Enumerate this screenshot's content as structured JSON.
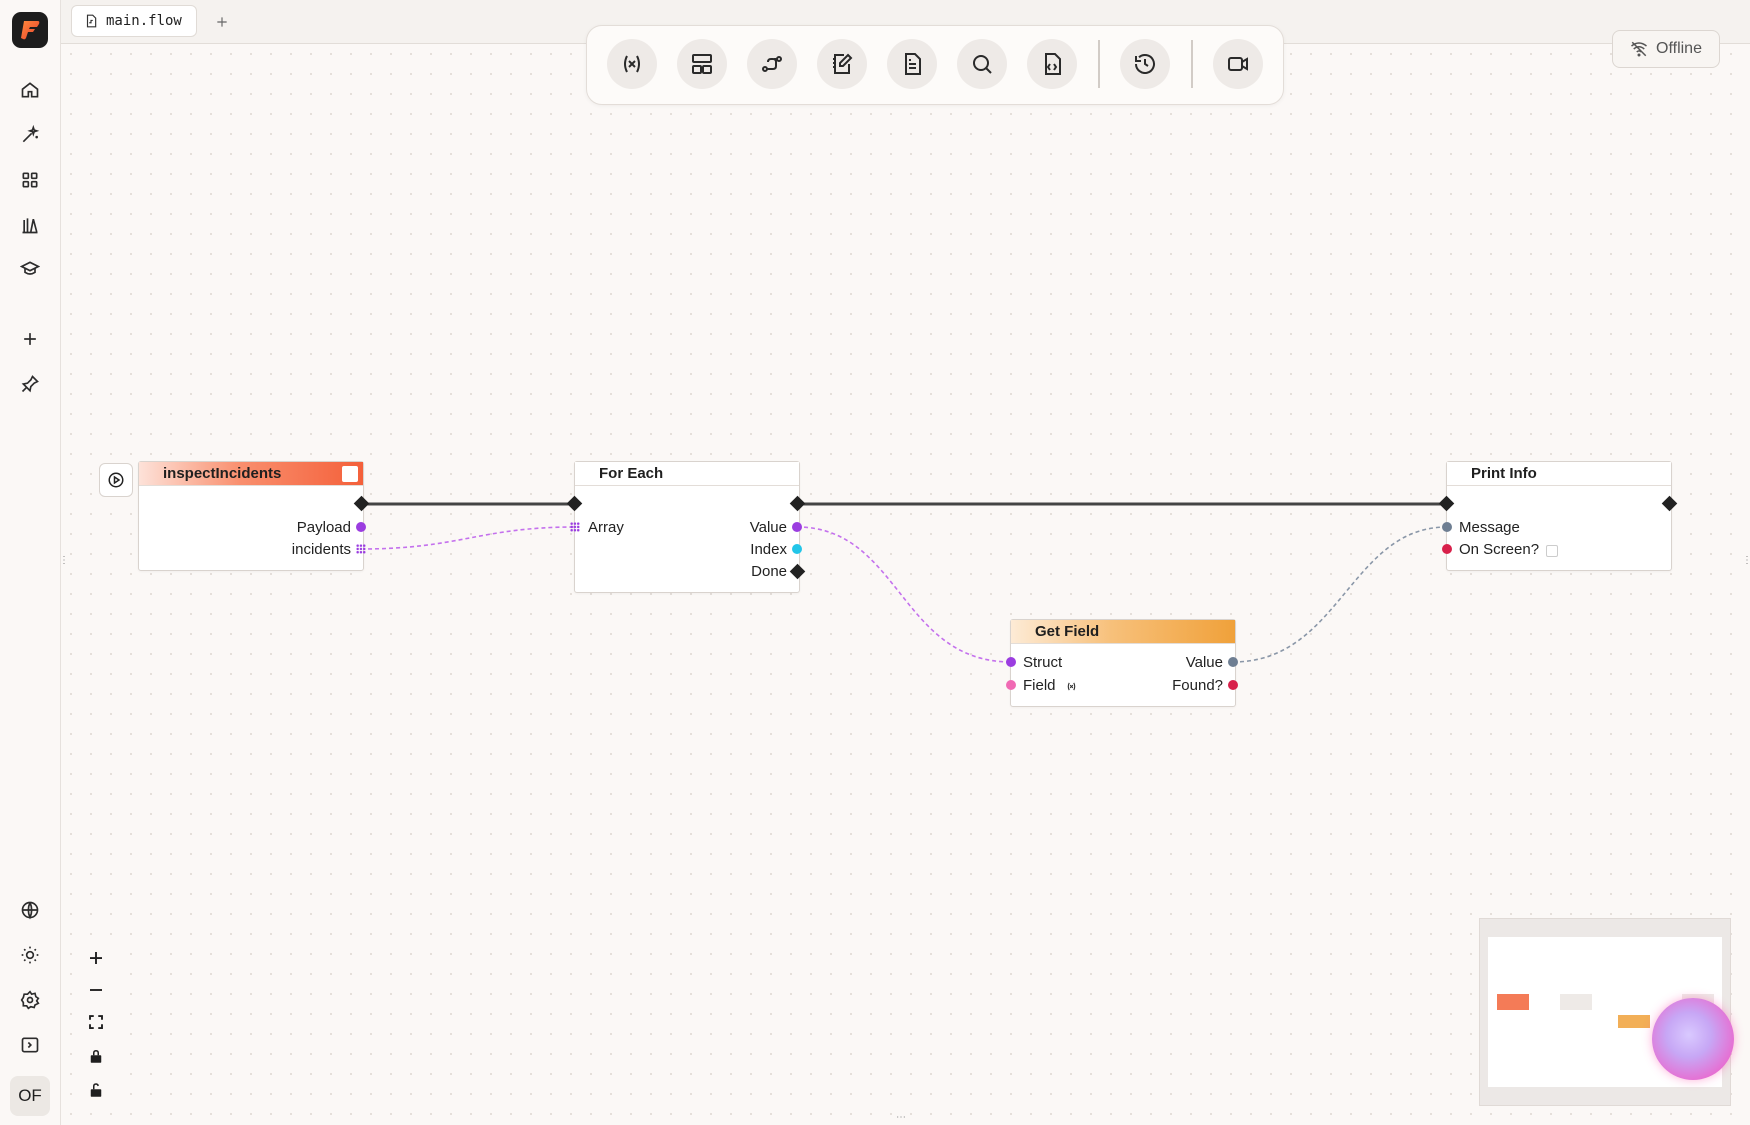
{
  "tabs": [
    {
      "label": "main.flow",
      "icon": "flow-file-icon"
    }
  ],
  "add_tab_label": "+",
  "status": {
    "label": "Offline",
    "icon": "wifi-off-icon"
  },
  "sidebar": {
    "top_items": [
      {
        "name": "home",
        "icon": "home-icon"
      },
      {
        "name": "magic",
        "icon": "sparkle-wand-icon"
      },
      {
        "name": "apps",
        "icon": "grid-icon"
      },
      {
        "name": "library",
        "icon": "library-icon"
      },
      {
        "name": "learn",
        "icon": "graduation-cap-icon"
      },
      {
        "name": "add",
        "icon": "plus-icon"
      },
      {
        "name": "pin",
        "icon": "pin-icon"
      }
    ],
    "bottom_items": [
      {
        "name": "language",
        "icon": "globe-icon"
      },
      {
        "name": "theme",
        "icon": "sun-icon"
      },
      {
        "name": "settings",
        "icon": "gear-icon"
      },
      {
        "name": "panel",
        "icon": "panel-right-icon"
      }
    ],
    "user_initials": "OF"
  },
  "toolbar": [
    {
      "name": "variables",
      "icon": "variable-icon"
    },
    {
      "name": "layout",
      "icon": "layout-icon"
    },
    {
      "name": "connections",
      "icon": "route-icon"
    },
    {
      "name": "notes",
      "icon": "notebook-pen-icon"
    },
    {
      "name": "document",
      "icon": "file-text-icon"
    },
    {
      "name": "search",
      "icon": "search-icon"
    },
    {
      "name": "code",
      "icon": "file-code-icon"
    },
    {
      "name": "history",
      "icon": "history-icon"
    },
    {
      "name": "record",
      "icon": "video-icon"
    }
  ],
  "nodes": {
    "inspect": {
      "title": "inspectIncidents",
      "outputs": [
        "Payload",
        "incidents"
      ],
      "header_color": "#f4603a"
    },
    "foreach": {
      "title": "For Each",
      "inputs": [
        "Array"
      ],
      "outputs": [
        "Value",
        "Index",
        "Done"
      ]
    },
    "getfield": {
      "title": "Get Field",
      "inputs": [
        "Struct",
        "Field"
      ],
      "outputs": [
        "Value",
        "Found?"
      ],
      "header_color": "#f0a13a"
    },
    "printinfo": {
      "title": "Print Info",
      "inputs": [
        "Message",
        "On Screen?"
      ]
    }
  },
  "pin_colors": {
    "struct": "#9b3de0",
    "integer": "#22c5e8",
    "string": "#f06ab4",
    "any": "#6e7e92",
    "boolean": "#d8204a"
  },
  "controls": [
    {
      "name": "zoom-in",
      "icon": "plus-icon"
    },
    {
      "name": "zoom-out",
      "icon": "minus-icon"
    },
    {
      "name": "fit-view",
      "icon": "maximize-icon"
    },
    {
      "name": "lock",
      "icon": "lock-icon"
    },
    {
      "name": "unlock",
      "icon": "unlock-icon"
    }
  ]
}
